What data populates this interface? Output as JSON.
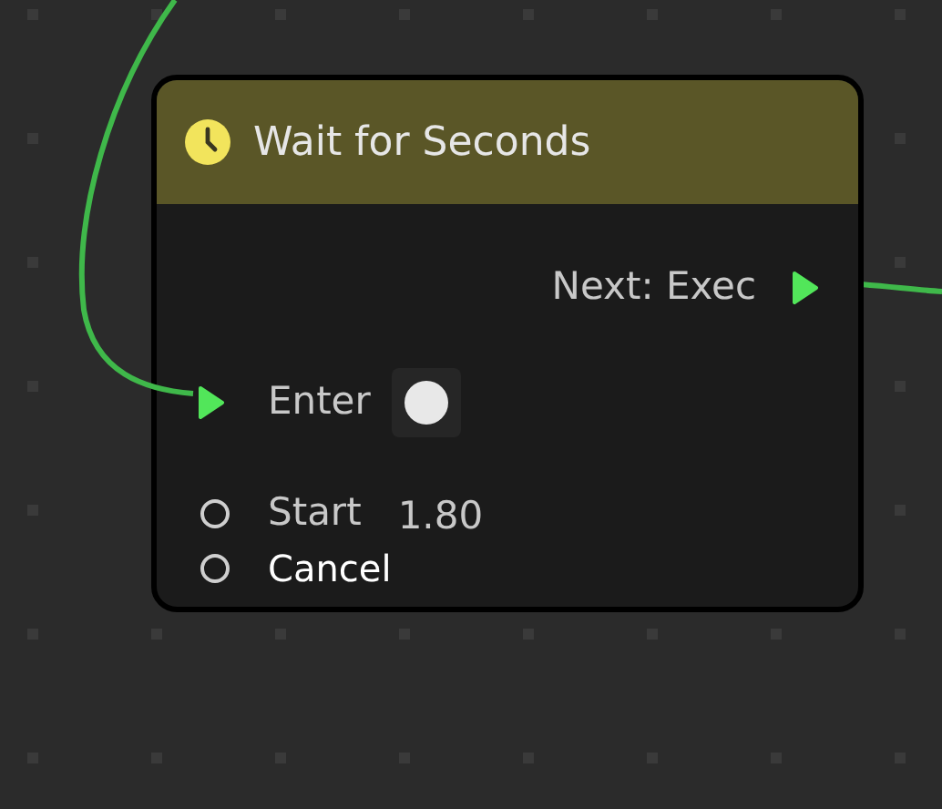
{
  "node": {
    "title": "Wait for Seconds",
    "outputs": [
      {
        "label": "Next: Exec",
        "kind": "exec",
        "connected": true
      }
    ],
    "inputs": [
      {
        "label": "Enter",
        "kind": "exec",
        "connected": true,
        "trigger": true
      },
      {
        "label": "Start",
        "kind": "data",
        "connected": false,
        "value": "1.80",
        "highlighted": false
      },
      {
        "label": "Cancel",
        "kind": "data",
        "connected": false,
        "highlighted": true
      }
    ]
  }
}
